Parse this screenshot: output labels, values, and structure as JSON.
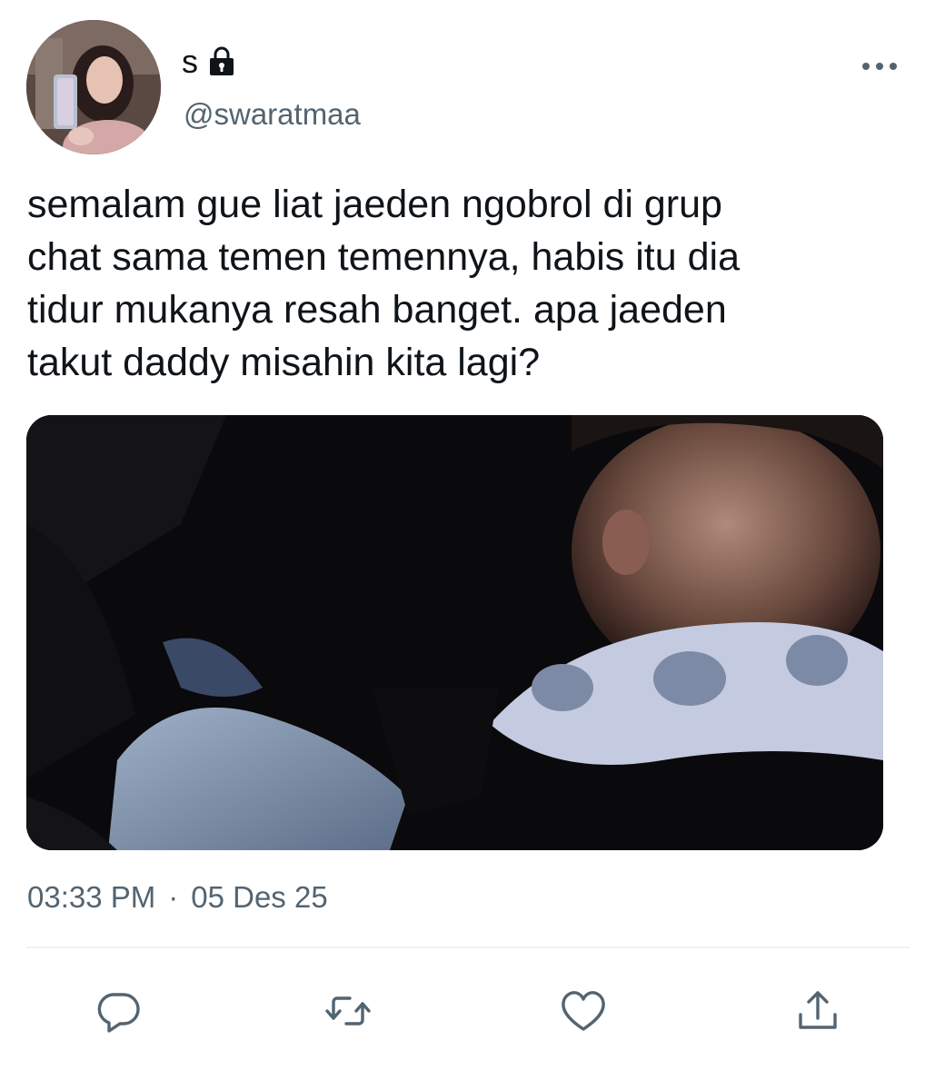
{
  "profile": {
    "display_name": "s",
    "handle": "@swaratmaa",
    "locked_icon": "lock-icon",
    "avatar_alt": "profile photo"
  },
  "header": {
    "more_icon": "more-options-icon"
  },
  "tweet": {
    "text": "semalam gue liat jaeden ngobrol di grup\nchat sama temen temennya, habis itu dia\ntidur mukanya resah banget. apa jaeden\ntakut daddy misahin kita lagi?",
    "time": "03:33 PM",
    "separator": "·",
    "date": "05 Des 25"
  },
  "actions": {
    "reply_icon": "reply-icon",
    "retweet_icon": "retweet-icon",
    "like_icon": "like-icon",
    "share_icon": "share-icon"
  },
  "colors": {
    "text_primary": "#0f1419",
    "text_secondary": "#536471",
    "divider": "#eff3f4",
    "icon": "#536471"
  }
}
